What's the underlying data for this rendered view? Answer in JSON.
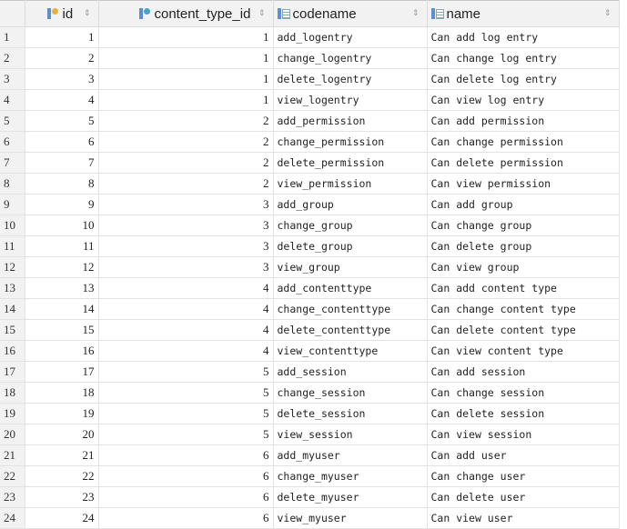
{
  "columns": [
    {
      "label": "",
      "icon": null
    },
    {
      "label": "id",
      "icon": "primary-key-icon"
    },
    {
      "label": "content_type_id",
      "icon": "foreign-key-icon"
    },
    {
      "label": "codename",
      "icon": "column-icon"
    },
    {
      "label": "name",
      "icon": "column-icon"
    }
  ],
  "sort_glyph": "⇕",
  "rows": [
    [
      1,
      1,
      1,
      "add_logentry",
      "Can add log entry"
    ],
    [
      2,
      2,
      1,
      "change_logentry",
      "Can change log entry"
    ],
    [
      3,
      3,
      1,
      "delete_logentry",
      "Can delete log entry"
    ],
    [
      4,
      4,
      1,
      "view_logentry",
      "Can view log entry"
    ],
    [
      5,
      5,
      2,
      "add_permission",
      "Can add permission"
    ],
    [
      6,
      6,
      2,
      "change_permission",
      "Can change permission"
    ],
    [
      7,
      7,
      2,
      "delete_permission",
      "Can delete permission"
    ],
    [
      8,
      8,
      2,
      "view_permission",
      "Can view permission"
    ],
    [
      9,
      9,
      3,
      "add_group",
      "Can add group"
    ],
    [
      10,
      10,
      3,
      "change_group",
      "Can change group"
    ],
    [
      11,
      11,
      3,
      "delete_group",
      "Can delete group"
    ],
    [
      12,
      12,
      3,
      "view_group",
      "Can view group"
    ],
    [
      13,
      13,
      4,
      "add_contenttype",
      "Can add content type"
    ],
    [
      14,
      14,
      4,
      "change_contenttype",
      "Can change content type"
    ],
    [
      15,
      15,
      4,
      "delete_contenttype",
      "Can delete content type"
    ],
    [
      16,
      16,
      4,
      "view_contenttype",
      "Can view content type"
    ],
    [
      17,
      17,
      5,
      "add_session",
      "Can add session"
    ],
    [
      18,
      18,
      5,
      "change_session",
      "Can change session"
    ],
    [
      19,
      19,
      5,
      "delete_session",
      "Can delete session"
    ],
    [
      20,
      20,
      5,
      "view_session",
      "Can view session"
    ],
    [
      21,
      21,
      6,
      "add_myuser",
      "Can add user"
    ],
    [
      22,
      22,
      6,
      "change_myuser",
      "Can change user"
    ],
    [
      23,
      23,
      6,
      "delete_myuser",
      "Can delete user"
    ],
    [
      24,
      24,
      6,
      "view_myuser",
      "Can view user"
    ]
  ]
}
